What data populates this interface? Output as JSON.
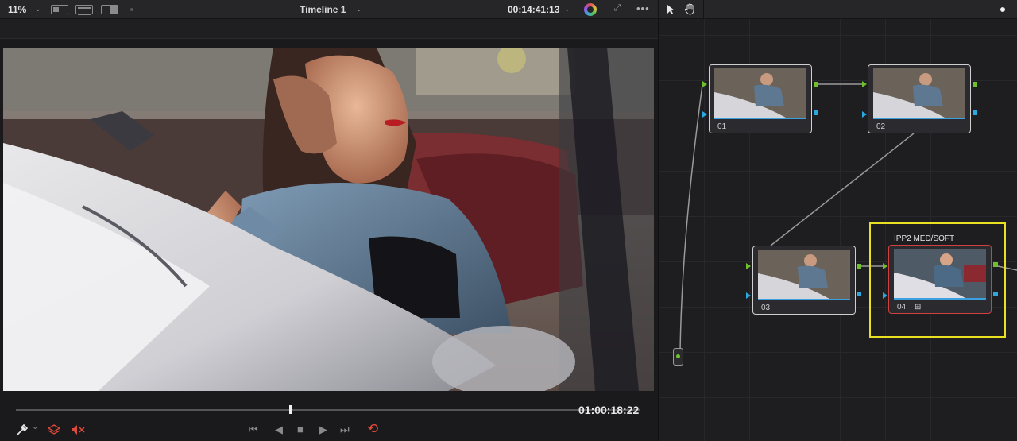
{
  "topbar": {
    "zoom": "11%",
    "timeline_title": "Timeline 1",
    "timecode": "00:14:41:13",
    "more": "•••"
  },
  "viewer": {
    "timecode": "01:00:18:22",
    "playhead_position": 0.44,
    "transport": {
      "first_frame": "⏮",
      "reverse": "◀",
      "stop": "■",
      "play": "▶",
      "last_frame": "⏭",
      "loop": "⟲"
    }
  },
  "nodes": {
    "items": [
      {
        "number": "01"
      },
      {
        "number": "02"
      },
      {
        "number": "03"
      },
      {
        "number": "04",
        "label": "IPP2 MED/SOFT"
      }
    ]
  },
  "colors": {
    "accent_green": "#6ec02c",
    "accent_blue": "#2ba8e0",
    "selection_yellow": "#e8e020",
    "selected_node_red": "#d04040",
    "loop_red": "#e04a3a"
  }
}
